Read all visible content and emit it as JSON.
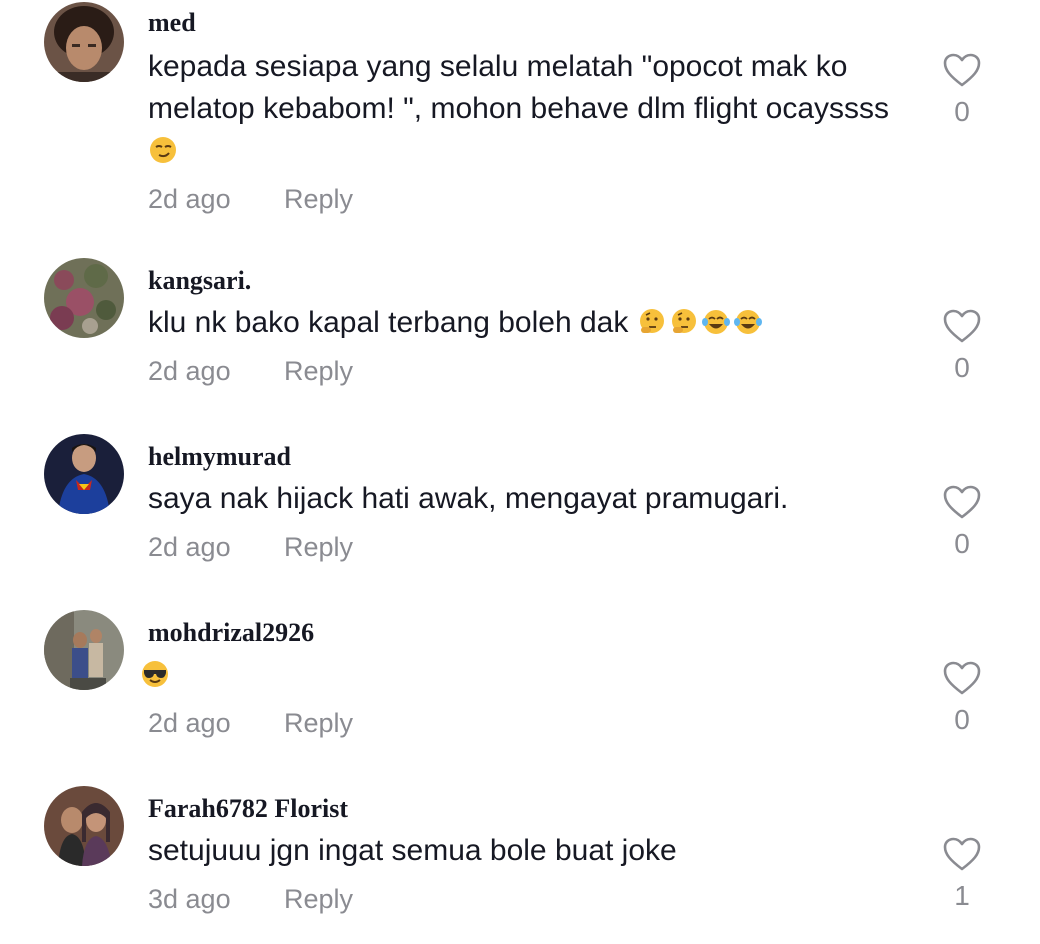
{
  "comments": [
    {
      "username": "med",
      "text": "kepada sesiapa yang selalu melatah \"opocot mak ko melatop kebabom! \", mohon behave dlm flight ocayssss",
      "emojis": [
        "smirking-face"
      ],
      "time": "2d ago",
      "reply_label": "Reply",
      "likes": "0"
    },
    {
      "username": "kangsari.",
      "text": "klu nk bako kapal terbang boleh dak",
      "emojis": [
        "thinking-face",
        "thinking-face",
        "tears-of-joy-face",
        "tears-of-joy-face"
      ],
      "time": "2d ago",
      "reply_label": "Reply",
      "likes": "0"
    },
    {
      "username": "helmymurad",
      "text": "saya nak hijack hati awak, mengayat pramugari.",
      "emojis": [],
      "time": "2d ago",
      "reply_label": "Reply",
      "likes": "0"
    },
    {
      "username": "mohdrizal2926",
      "text": "",
      "emojis": [
        "sunglasses-face"
      ],
      "time": "2d ago",
      "reply_label": "Reply",
      "likes": "0"
    },
    {
      "username": "Farah6782 Florist",
      "text": "setujuuu jgn ingat semua bole buat joke",
      "emojis": [],
      "time": "3d ago",
      "reply_label": "Reply",
      "likes": "1"
    }
  ],
  "colors": {
    "text_primary": "#161823",
    "text_secondary": "#8a8b91",
    "icon_stroke": "#8a8b91"
  },
  "icons": {
    "like": "heart-outline-icon"
  }
}
